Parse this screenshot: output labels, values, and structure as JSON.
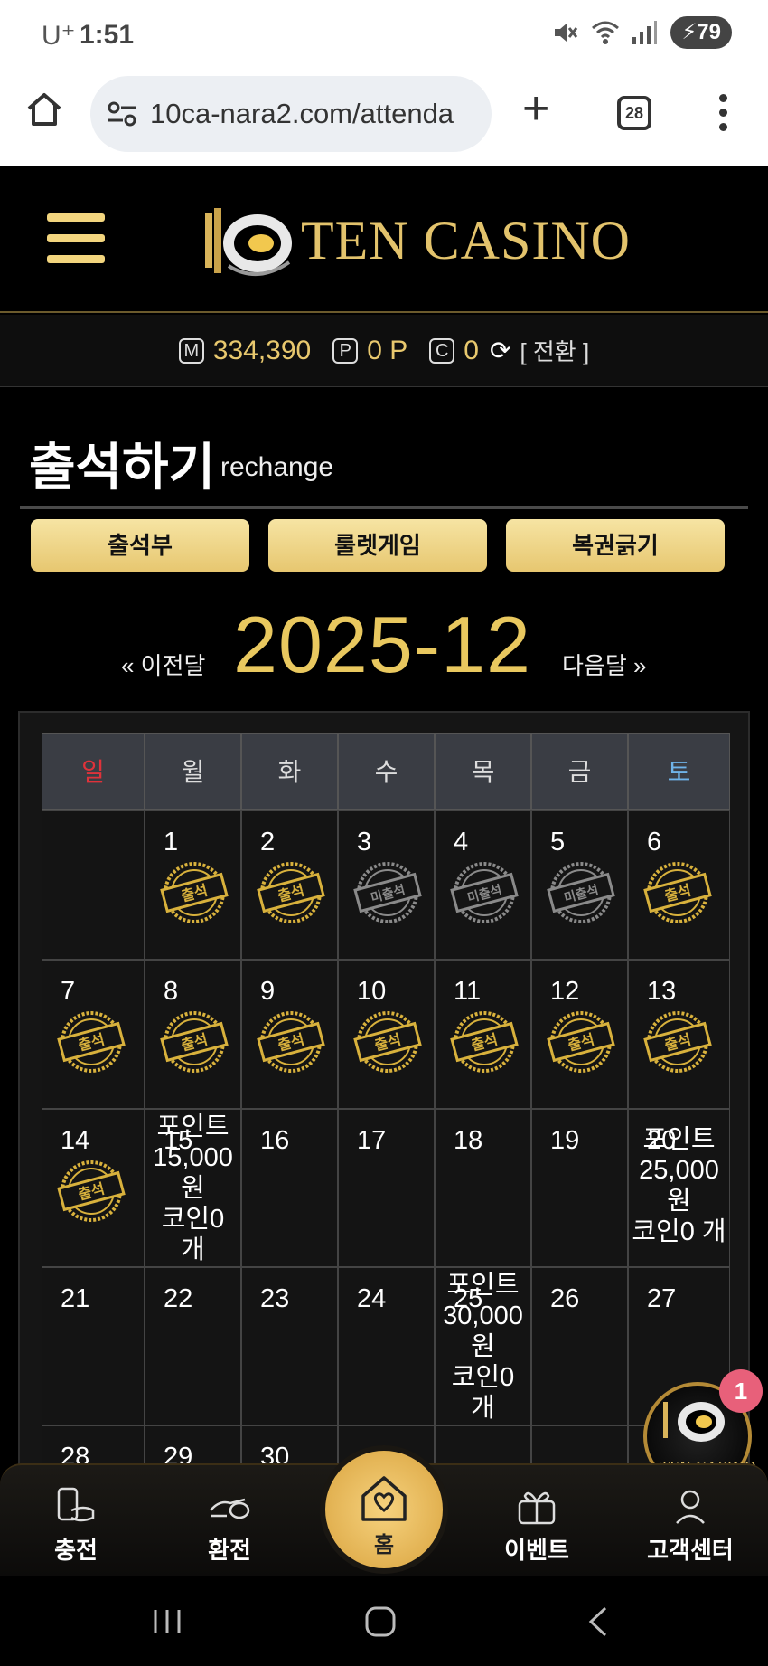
{
  "status_bar": {
    "carrier": "U⁺",
    "time": "1:51",
    "battery": "79"
  },
  "browser": {
    "url": "10ca-nara2.com/attenda",
    "tabs_count": "28"
  },
  "site": {
    "logo_text": "TEN CASINO"
  },
  "balance": {
    "money_icon": "M",
    "money": "334,390",
    "point_icon": "P",
    "points": "0 P",
    "coin_icon": "C",
    "coins": "0",
    "switch_label": "[ 전환 ]"
  },
  "page": {
    "title": "출석하기",
    "subtitle": "rechange"
  },
  "tabs": [
    {
      "label": "출석부"
    },
    {
      "label": "룰렛게임"
    },
    {
      "label": "복권긁기"
    }
  ],
  "month_nav": {
    "prev": "« 이전달",
    "current": "2025-12",
    "next": "다음달 »"
  },
  "calendar": {
    "weekdays": [
      "일",
      "월",
      "화",
      "수",
      "목",
      "금",
      "토"
    ],
    "weekday_colors": {
      "sun": "#e0323a",
      "sat": "#6fb3e8",
      "default": "#dddddd"
    },
    "days": {
      "d1": "1",
      "d2": "2",
      "d3": "3",
      "d4": "4",
      "d5": "5",
      "d6": "6",
      "d7": "7",
      "d8": "8",
      "d9": "9",
      "d10": "10",
      "d11": "11",
      "d12": "12",
      "d13": "13",
      "d14": "14",
      "d15": "15",
      "d16": "16",
      "d17": "17",
      "d18": "18",
      "d19": "19",
      "d20": "20",
      "d21": "21",
      "d22": "22",
      "d23": "23",
      "d24": "24",
      "d25": "25",
      "d26": "26",
      "d27": "27",
      "d28": "28",
      "d29": "29",
      "d30": "30"
    },
    "stamp_attended": "출석",
    "stamp_absent": "미출석",
    "prizes": {
      "p15": {
        "l1": "포인트",
        "l2": "15,000",
        "l3": "원",
        "l4": "코인0",
        "l5": "개"
      },
      "p20": {
        "l1": "포인트",
        "l2": "25,000",
        "l3": "원",
        "l4": "코인0 개"
      },
      "p25": {
        "l1": "포인트",
        "l2": "30,000",
        "l3": "원",
        "l4": "코인0",
        "l5": "개"
      }
    }
  },
  "floating": {
    "badge_count": "1",
    "logo_text": "TEN CASINO"
  },
  "bottom_nav": {
    "charge": "충전",
    "exchange": "환전",
    "home": "홈",
    "event": "이벤트",
    "support": "고객센터"
  },
  "colors": {
    "gold": "#e9c85f",
    "button_gold": "#f2d98a",
    "background": "#000000"
  }
}
